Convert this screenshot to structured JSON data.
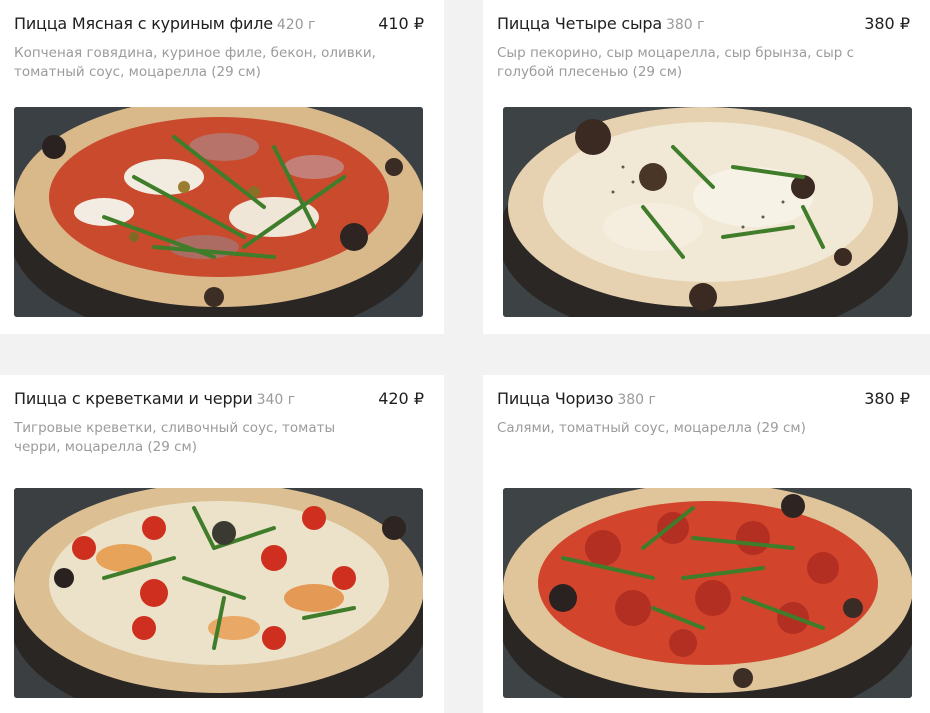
{
  "currency": "₽",
  "items": [
    {
      "name": "Пицца Мясная с куриным филе",
      "weight": "420 г",
      "price": "410 ₽",
      "description": "Копченая говядина, куриное филе, бекон, оливки, томатный соус, моцарелла (29 см)"
    },
    {
      "name": "Пицца Четыре сыра",
      "weight": "380 г",
      "price": "380 ₽",
      "description": "Сыр пекорино, сыр моцарелла, сыр брынза, сыр с голубой плесенью (29 см)"
    },
    {
      "name": "Пицца с креветками и черри",
      "weight": "340 г",
      "price": "420 ₽",
      "description": "Тигровые креветки, сливочный соус, томаты черри, моцарелла (29 см)"
    },
    {
      "name": "Пицца Чоризо",
      "weight": "380 г",
      "price": "380 ₽",
      "description": "Салями, томатный соус, моцарелла (29 см)"
    }
  ],
  "colors": {
    "background": "#f2f2f2",
    "card": "#ffffff",
    "title": "#21201f",
    "secondary": "#9b9b9b"
  }
}
